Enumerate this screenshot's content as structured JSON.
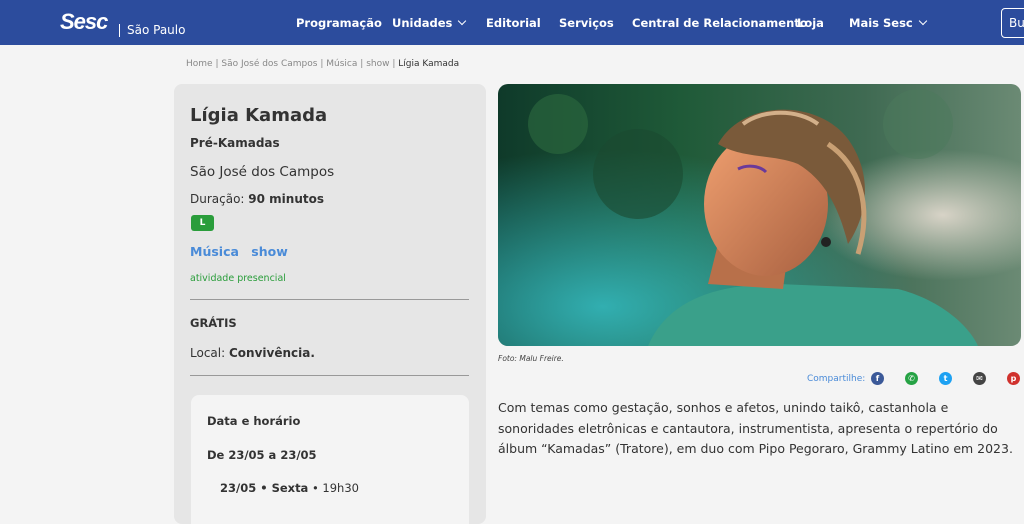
{
  "header": {
    "logo_text": "Sesc",
    "logo_subtitle": "São Paulo",
    "nav": [
      {
        "label": "Programação",
        "has_dropdown": false
      },
      {
        "label": "Unidades",
        "has_dropdown": true
      },
      {
        "label": "Editorial",
        "has_dropdown": false
      },
      {
        "label": "Serviços",
        "has_dropdown": false
      },
      {
        "label": "Central de Relacionamento",
        "has_dropdown": false
      },
      {
        "label": "Loja",
        "has_dropdown": false
      },
      {
        "label": "Mais Sesc",
        "has_dropdown": true
      }
    ],
    "partial_button_label": "Bu"
  },
  "breadcrumb": [
    {
      "label": "Home"
    },
    {
      "label": "São José dos Campos"
    },
    {
      "label": "Música"
    },
    {
      "label": "show"
    },
    {
      "label": "Lígia Kamada"
    }
  ],
  "breadcrumb_separator": "|",
  "event": {
    "title": "Lígia Kamada",
    "subtitle": "Pré-Kamadas",
    "city": "São José dos Campos",
    "duration_label": "Duração:",
    "duration_value": "90 minutos",
    "age_rating": "L",
    "tags": [
      "Música",
      "show"
    ],
    "modality": "atividade presencial",
    "price": "GRÁTIS",
    "location_label": "Local:",
    "location_value": "Convivência."
  },
  "schedule": {
    "title": "Data e horário",
    "range": "De 23/05 a 23/05",
    "entries": [
      {
        "date_day": "23/05 • Sexta",
        "time": "• 19h30"
      }
    ]
  },
  "media": {
    "photo_credit": "Foto: Malu Freire."
  },
  "share": {
    "label": "Compartilhe:",
    "icons": [
      "facebook-icon",
      "whatsapp-icon",
      "twitter-icon",
      "email-icon",
      "pinterest-icon"
    ]
  },
  "description": "Com temas como gestação, sonhos e afetos, unindo taikô, castanhola e sonoridades eletrônicas e cantautora, instrumentista, apresenta o repertório do álbum “Kamadas” (Tratore), em duo com Pipo Pegoraro, Grammy Latino em 2023.",
  "colors": {
    "header_bg": "#2c4c9d",
    "link_blue": "#4a8bd8",
    "green": "#2a9d3b",
    "facebook": "#3b5998",
    "whatsapp": "#25a244",
    "twitter": "#1da1f2",
    "email": "#444444",
    "pinterest": "#d0312d"
  }
}
